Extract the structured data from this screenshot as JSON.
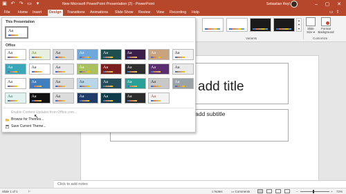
{
  "window": {
    "title": "New Microsoft PowerPoint Presentation (2) - PowerPoint",
    "user": "Sebastian Reyl",
    "controls": [
      "minimize-icon",
      "restore-icon",
      "close-icon"
    ]
  },
  "quick_access": [
    "save-icon",
    "undo-icon",
    "redo-icon",
    "present-icon",
    "customize-icon"
  ],
  "tabs": [
    "File",
    "Home",
    "Insert",
    "Design",
    "Transitions",
    "Animations",
    "Slide Show",
    "Review",
    "View",
    "Recording",
    "Help"
  ],
  "active_tab": "Design",
  "ribbon": {
    "variants_label": "Variants",
    "customize_label": "Customize",
    "slide_size": "Slide Size",
    "slide_size_line1": "Slide",
    "slide_size_line2": "Size ▾",
    "format_background_line1": "Format",
    "format_background_line2": "Background",
    "variants": [
      {
        "bg": "#ffffff",
        "accent": "#4472c4"
      },
      {
        "bg": "#ffffff",
        "accent": "#5b9bd5"
      },
      {
        "bg": "#1a1a1a",
        "accent": "#4472c4"
      },
      {
        "bg": "#1a1a1a",
        "accent": "#70ad47"
      }
    ]
  },
  "themes_panel": {
    "this_presentation_label": "This Presentation",
    "office_label": "Office",
    "current_theme_text": "Aa",
    "themes": [
      {
        "bg": "#ffffff",
        "fg": "#222222",
        "text": "Aa"
      },
      {
        "bg": "#e9f0e0",
        "fg": "#6a8a2a",
        "text": "Aa"
      },
      {
        "bg": "#d9d9d9",
        "fg": "#222222",
        "text": "Aa"
      },
      {
        "bg": "#6fa8dc",
        "fg": "#ffffff",
        "text": "Aa"
      },
      {
        "bg": "#1f4e4e",
        "fg": "#ffffff",
        "text": "Aa"
      },
      {
        "bg": "#3b1f4a",
        "fg": "#ffffff",
        "text": "Aa"
      },
      {
        "bg": "#c9a27e",
        "fg": "#ffffff",
        "text": "Aa"
      },
      {
        "bg": "#f2f2f2",
        "fg": "#222222",
        "text": "Aa"
      },
      {
        "bg": "#3aa6b9",
        "fg": "#ffffff",
        "text": "Aa"
      },
      {
        "bg": "#ffffff",
        "fg": "#222222",
        "text": "Aa"
      },
      {
        "bg": "#e8e8e8",
        "fg": "#222222",
        "text": "Aa"
      },
      {
        "bg": "#a9c25d",
        "fg": "#ffffff",
        "text": "Aa"
      },
      {
        "bg": "#7b1e1e",
        "fg": "#ffffff",
        "text": "Aa"
      },
      {
        "bg": "#2f2f2f",
        "fg": "#ffffff",
        "text": "Aa"
      },
      {
        "bg": "#5b2c6f",
        "fg": "#ffffff",
        "text": "Aa"
      },
      {
        "bg": "#eaeaea",
        "fg": "#222222",
        "text": "Aa"
      },
      {
        "bg": "#ffffff",
        "fg": "#222222",
        "text": "Aa"
      },
      {
        "bg": "#3f7fbf",
        "fg": "#ffffff",
        "text": "Aa"
      },
      {
        "bg": "#dadada",
        "fg": "#222222",
        "text": "Aa"
      },
      {
        "bg": "#b8d6e8",
        "fg": "#1f3b57",
        "text": "Aa"
      },
      {
        "bg": "#234e5a",
        "fg": "#ffffff",
        "text": "Aa"
      },
      {
        "bg": "#2aa198",
        "fg": "#ffffff",
        "text": "Aa"
      },
      {
        "bg": "#c8c8c8",
        "fg": "#222222",
        "text": "Aa"
      },
      {
        "bg": "#9aa4a8",
        "fg": "#ffffff",
        "text": "Aa"
      },
      {
        "bg": "#e0f3f0",
        "fg": "#2a6a5a",
        "text": "Aa"
      },
      {
        "bg": "#111111",
        "fg": "#ffffff",
        "text": "Aa"
      },
      {
        "bg": "#dcdcdc",
        "fg": "#222222",
        "text": "Aa"
      },
      {
        "bg": "#1f3b6a",
        "fg": "#ffffff",
        "text": "Aa"
      },
      {
        "bg": "#0e3a4a",
        "fg": "#ffffff",
        "text": "Aa"
      },
      {
        "bg": "#2b2b2b",
        "fg": "#ffffff",
        "text": "Aa"
      },
      {
        "bg": "#f3f3f3",
        "fg": "#a33",
        "text": "Aa"
      }
    ],
    "menu": {
      "enable_updates": "Enable Content Updates from Office.com...",
      "browse": "Browse for Themes...",
      "save": "Save Current Theme..."
    }
  },
  "slide": {
    "title_placeholder": "Click to add title",
    "title_visible": "add title",
    "subtitle_visible": "add subtitle"
  },
  "notes_placeholder": "Click to add notes",
  "status": {
    "slide_info": "Slide 1 of 1",
    "notes_label": "Notes",
    "comments_label": "Comments",
    "zoom": "72%"
  }
}
